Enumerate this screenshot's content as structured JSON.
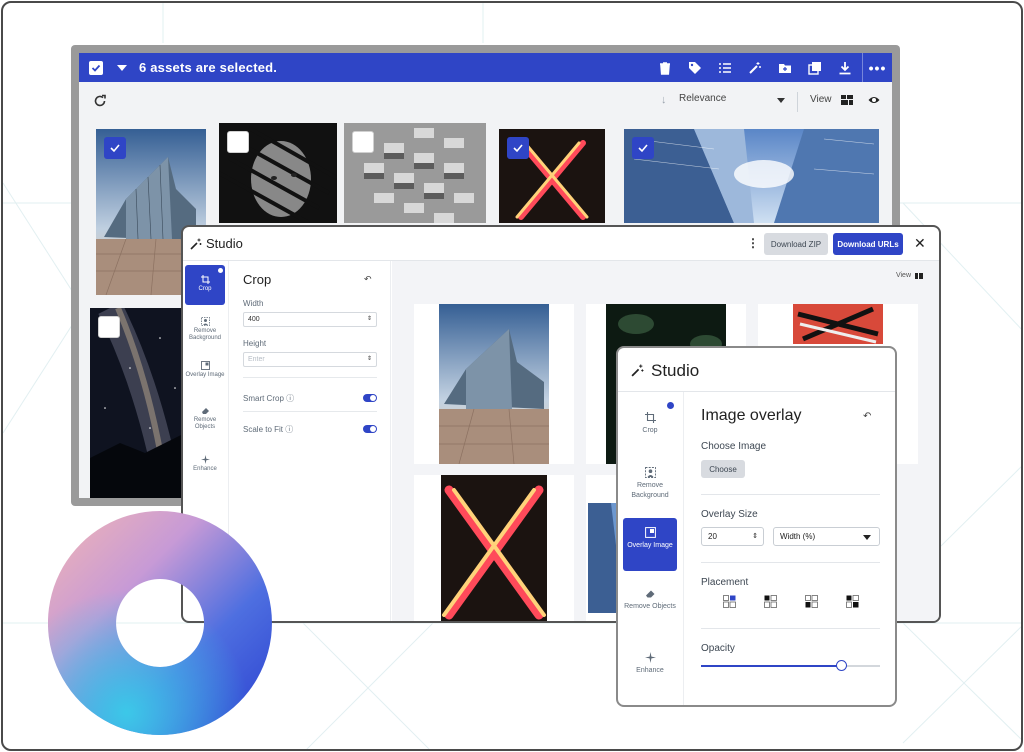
{
  "colors": {
    "accent": "#2f45c6",
    "frame": "#4a4a4a",
    "canvas": "#f3f4f7"
  },
  "library": {
    "selection_text": "6 assets are selected.",
    "toolbar_icons": [
      "trash-icon",
      "tag-icon",
      "list-icon",
      "magic-wand-icon",
      "folder-icon",
      "copy-icon",
      "download-icon"
    ],
    "more_label": "•••",
    "sort_label": "Relevance",
    "view_label": "View",
    "thumbnails": [
      {
        "name": "titanic-building",
        "checked": true
      },
      {
        "name": "striped-portrait",
        "checked": false
      },
      {
        "name": "concrete-pattern",
        "checked": false
      },
      {
        "name": "neon-x",
        "checked": true
      },
      {
        "name": "skyscrapers-up",
        "checked": true
      },
      {
        "name": "milky-way",
        "checked": false
      }
    ]
  },
  "studio_crop": {
    "title": "Studio",
    "kebab": "⋮",
    "download_zip": "Download ZIP",
    "download_urls": "Download URLs",
    "close": "✕",
    "rail": [
      {
        "label": "Crop",
        "icon": "crop-icon",
        "active": true
      },
      {
        "label": "Remove Background",
        "icon": "remove-background-icon",
        "active": false
      },
      {
        "label": "Overlay Image",
        "icon": "overlay-image-icon",
        "active": false
      },
      {
        "label": "Remove Objects",
        "icon": "eraser-icon",
        "active": false
      },
      {
        "label": "Enhance",
        "icon": "sparkle-icon",
        "active": false
      }
    ],
    "panel": {
      "title": "Crop",
      "undo": "↶",
      "width_label": "Width",
      "width_value": "400",
      "height_label": "Height",
      "height_placeholder": "Enter",
      "smart_crop_label": "Smart Crop ⓘ",
      "smart_crop_on": true,
      "scale_to_fit_label": "Scale to Fit ⓘ",
      "scale_to_fit_on": true
    },
    "view_label": "View"
  },
  "studio_overlay": {
    "title": "Studio",
    "rail": [
      {
        "label": "Crop",
        "icon": "crop-icon"
      },
      {
        "label": "Remove Background",
        "icon": "remove-background-icon"
      },
      {
        "label": "Overlay Image",
        "icon": "overlay-image-icon",
        "active": true
      },
      {
        "label": "Remove Objects",
        "icon": "eraser-icon"
      },
      {
        "label": "Enhance",
        "icon": "sparkle-icon"
      }
    ],
    "panel": {
      "title": "Image overlay",
      "undo": "↶",
      "choose_image_label": "Choose Image",
      "choose_button": "Choose",
      "overlay_size_label": "Overlay Size",
      "overlay_size_value": "20",
      "overlay_unit": "Width (%)",
      "placement_label": "Placement",
      "placement_options": [
        "top-right",
        "top-left",
        "bottom-left",
        "bottom-right"
      ],
      "opacity_label": "Opacity",
      "opacity_value": 0.78
    }
  }
}
